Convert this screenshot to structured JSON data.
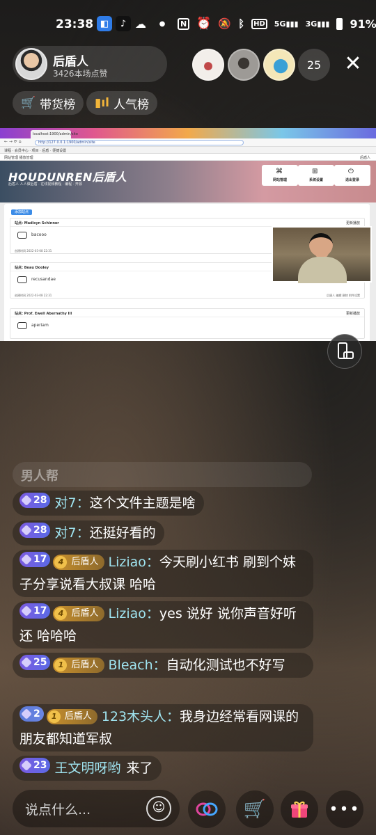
{
  "status_bar": {
    "time": "23:38",
    "icons": [
      "app-icon",
      "tiktok-icon",
      "wechat-icon",
      "dot-icon",
      "nfc-icon",
      "alarm-icon",
      "mute-icon",
      "bluetooth-icon",
      "hd-icon",
      "5g-signal-icon",
      "3g-signal-icon",
      "battery-icon"
    ],
    "signal_5g": "5G",
    "signal_3g": "3G",
    "battery": "91%"
  },
  "host": {
    "name": "后盾人",
    "likes": "3426本场点赞"
  },
  "viewer_count": "25",
  "pills": [
    {
      "label": "带货榜",
      "icon": "cart-icon"
    },
    {
      "label": "人气榜",
      "icon": "bar-chart-icon"
    }
  ],
  "screen": {
    "tab_title": "localhost:1900/admin/site",
    "url": "http://127.0.0.1:1900/admin/site",
    "bookmarks": "课程 · 会员中心 · 项目 · 后盾 · 便捷设置",
    "appbar_left": "网站管理   播放管理",
    "appbar_right": "后盾人",
    "brand": "HOUDUNREN后盾人",
    "slogan": "后盾人 人人做后盾 · 在线视频教程 · 编程 · 开源",
    "header_buttons": [
      "网站管理",
      "系统设置",
      "退出登录"
    ],
    "new_button": "添加站点",
    "cards": [
      {
        "head": "站点: Madisyn Schinner",
        "head_right": "更新播放",
        "body": "bacooo",
        "foot": "创建时间 2022-03-08 22:31",
        "foot_right": ""
      },
      {
        "head": "站点: Beau Dooley",
        "head_right": "",
        "body": "recusandae",
        "foot": "创建时间 2022-03-08 22:31",
        "foot_right": "后盾人  编辑  删除  附件设置"
      },
      {
        "head": "站点: Prof. Ewell Abernathy III",
        "head_right": "更新播放",
        "body": "aperiam",
        "foot": "",
        "foot_right": ""
      }
    ]
  },
  "chat": {
    "faded": "男人帮",
    "messages": [
      {
        "level": "28",
        "fan_level": "",
        "fan_label": "",
        "user": "对7",
        "text": "这个文件主题是啥"
      },
      {
        "level": "28",
        "fan_level": "",
        "fan_label": "",
        "user": "对7",
        "text": "还挺好看的"
      },
      {
        "level": "17",
        "fan_level": "4",
        "fan_label": "后盾人",
        "user": "Liziao",
        "text": "今天刷小红书 刷到个妹子分享说看大叔课  哈哈"
      },
      {
        "level": "17",
        "fan_level": "4",
        "fan_label": "后盾人",
        "user": "Liziao",
        "text": "yes 说好 说你声音好听还 哈哈哈"
      },
      {
        "level": "25",
        "fan_level": "1",
        "fan_label": "后盾人",
        "user": "Bleach",
        "text": "自动化测试也不好写"
      },
      {
        "level": "2",
        "fan_level": "1",
        "fan_label": "后盾人",
        "user": "123木头人",
        "text": "我身边经常看网课的朋友都知道军叔"
      },
      {
        "level": "23",
        "fan_level": "",
        "fan_label": "",
        "user": "王文明呀哟",
        "text": "来了"
      }
    ]
  },
  "bottom": {
    "input_placeholder": "说点什么...",
    "buttons": [
      "emoji-icon",
      "link-icon",
      "shopping-cart-icon",
      "gift-icon",
      "more-icon"
    ]
  },
  "colors": {
    "username": "#9fe3ef",
    "level_badge": "#6a5ee4",
    "fan_badge": "#c8902d"
  }
}
